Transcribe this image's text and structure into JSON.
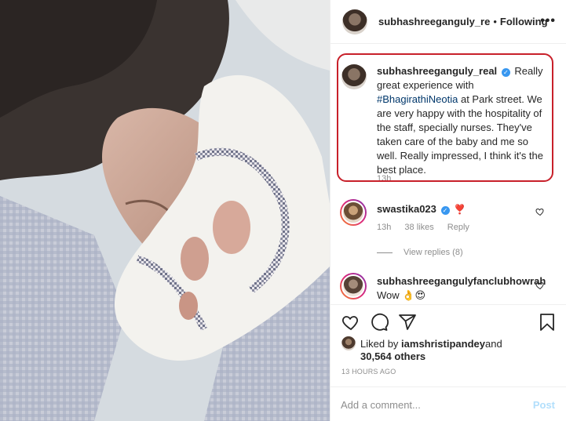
{
  "post": {
    "username": "subhashreeganguly_re",
    "separator": "•",
    "follow_status": "Following",
    "more_label": "•••"
  },
  "caption": {
    "username": "subhashreeganguly_real",
    "verified_mark": "✓",
    "text_before": "Really great experience with ",
    "hashtag": "#BhagirathiNeotia",
    "text_after": " at Park street. We are very happy with the hospitality of the staff, specially nurses. They've taken care of the baby and me so well. Really impressed, I think it's the best place.",
    "time": "13h",
    "highlight_color": "#c8202a"
  },
  "comments": [
    {
      "username": "swastika023",
      "verified_mark": "✓",
      "text": "❣️",
      "time": "13h",
      "likes": "38 likes",
      "reply": "Reply",
      "view_replies": "View replies (8)"
    },
    {
      "username": "subhashreegangulyfanclubhowrah",
      "text": "Wow 👌😍"
    }
  ],
  "engagement": {
    "liked_by_prefix": "Liked by ",
    "liked_by_user": "iamshristipandey",
    "liked_by_suffix": " and",
    "others": "30,564 others",
    "posted_ago": "13 HOURS AGO"
  },
  "composer": {
    "placeholder": "Add a comment...",
    "post_label": "Post"
  },
  "icons": [
    "heart-icon",
    "comment-icon",
    "share-icon",
    "bookmark-icon",
    "more-icon",
    "verified-icon"
  ],
  "colors": {
    "link": "#00376b",
    "verified": "#3897f0",
    "muted": "#8e8e8e",
    "post_disabled": "#b2dffc"
  }
}
